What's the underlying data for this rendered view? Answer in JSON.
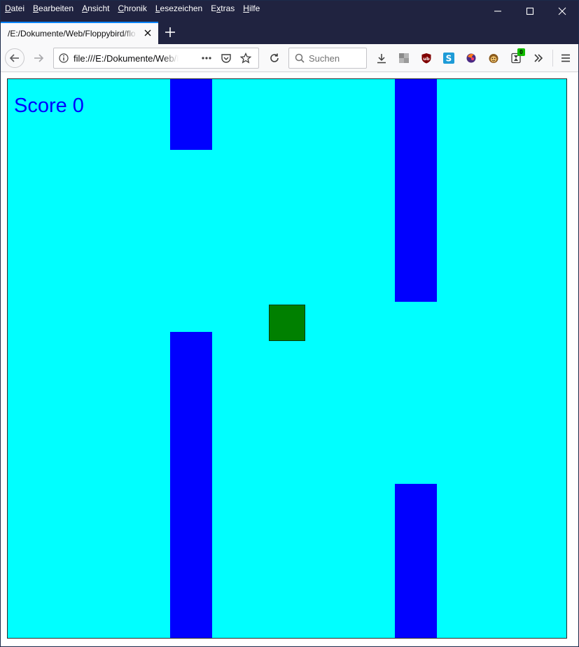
{
  "menu": [
    "Datei",
    "Bearbeiten",
    "Ansicht",
    "Chronik",
    "Lesezeichen",
    "Extras",
    "Hilfe"
  ],
  "menu_access_keys": [
    "D",
    "B",
    "A",
    "C",
    "L",
    "x",
    "H"
  ],
  "tab": {
    "title": "/E:/Dokumente/Web/Floppybird/flo"
  },
  "urlbar": {
    "url": "file:///E:/Dokumente/Web/Floppybird/floppybird.html"
  },
  "search": {
    "placeholder": "Suchen"
  },
  "toolbar": {
    "badge_count": "0"
  },
  "game": {
    "score_label": "Score",
    "score_value": "0",
    "colors": {
      "sky": "#00ffff",
      "pipe": "#0000ff",
      "bird": "#008000",
      "score": "#0000ff"
    }
  }
}
